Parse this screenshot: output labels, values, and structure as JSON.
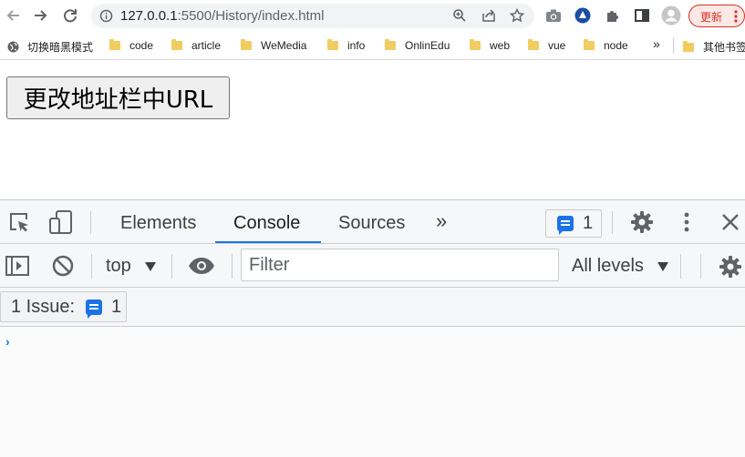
{
  "browser": {
    "url_host": "127.0.0.1",
    "url_rest": ":5500/History/index.html",
    "update_label": "更新",
    "icons": [
      "back-icon",
      "forward-icon",
      "reload-icon",
      "info-icon",
      "zoom-icon",
      "share-icon",
      "star-icon",
      "camera-icon",
      "profile-ext-icon",
      "puzzle-icon",
      "sidebar-icon",
      "avatar-icon",
      "kebab-icon"
    ]
  },
  "bookmarks": {
    "first": "切换暗黑模式",
    "items": [
      "code",
      "article",
      "WeMedia",
      "info",
      "OnlinEdu",
      "web",
      "vue",
      "node"
    ],
    "more": "»",
    "other": "其他书签"
  },
  "page": {
    "button_label": "更改地址栏中URL"
  },
  "devtools": {
    "tabs": [
      "Elements",
      "Console",
      "Sources"
    ],
    "active_tab": "Console",
    "more_tabs": "»",
    "issues_badge_count": "1",
    "context": "top",
    "filter_placeholder": "Filter",
    "levels": "All levels",
    "issue_label": "1 Issue:",
    "issue_count": "1",
    "prompt": "›",
    "accent": "#1a73e8"
  }
}
